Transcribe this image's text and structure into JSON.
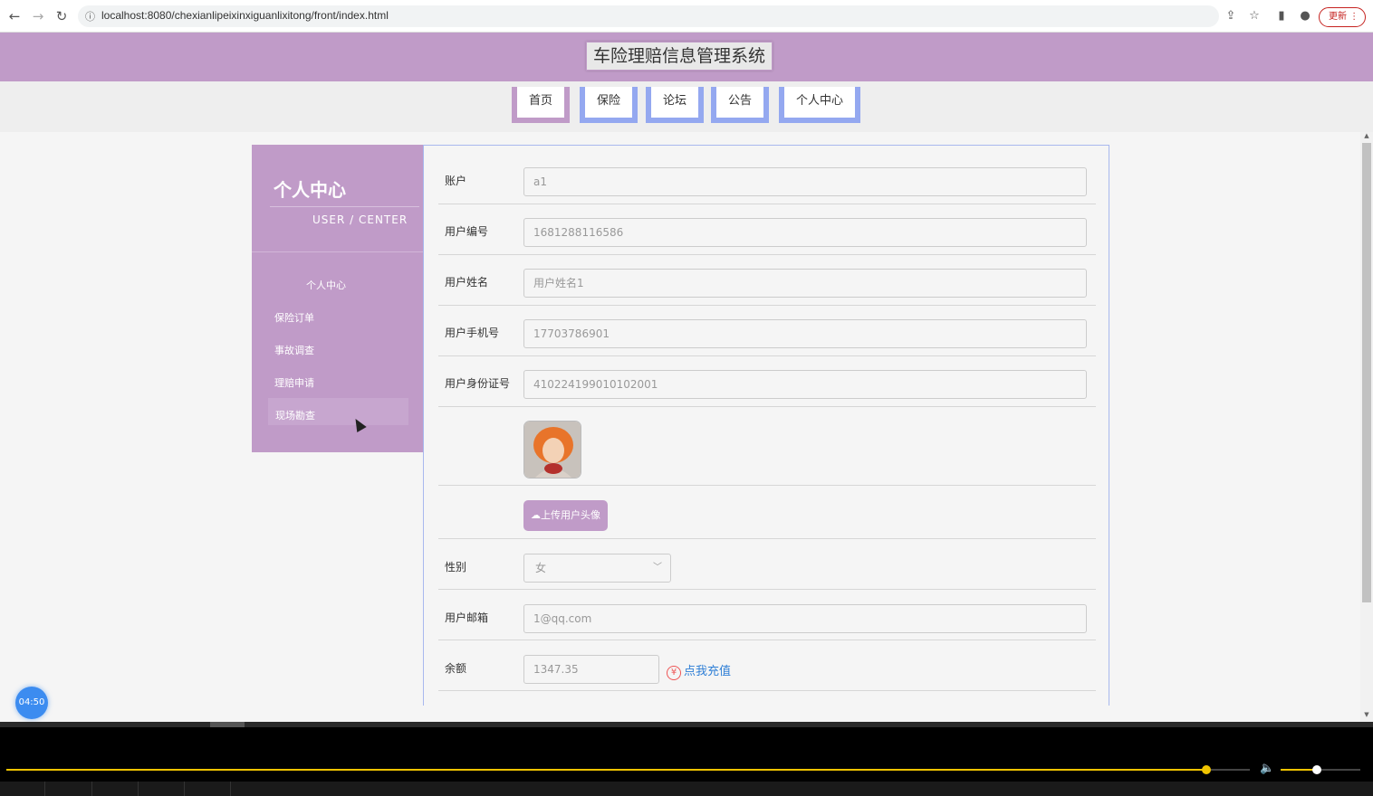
{
  "browser": {
    "url": "localhost:8080/chexianlipeixinxiguanlixitong/front/index.html",
    "update_label": "更新"
  },
  "site": {
    "title": "车险理赔信息管理系统"
  },
  "nav": {
    "items": [
      {
        "label": "首页",
        "active": true
      },
      {
        "label": "保险",
        "active": false
      },
      {
        "label": "论坛",
        "active": false
      },
      {
        "label": "公告",
        "active": false
      },
      {
        "label": "个人中心",
        "active": false
      }
    ]
  },
  "sidebar": {
    "title": "个人中心",
    "subtitle": "USER / CENTER",
    "items": [
      "个人中心",
      "保险订单",
      "事故调查",
      "理赔申请",
      "现场勘查"
    ]
  },
  "form": {
    "account_label": "账户",
    "account_value": "a1",
    "user_no_label": "用户编号",
    "user_no_value": "1681288116586",
    "user_name_label": "用户姓名",
    "user_name_value": "用户姓名1",
    "phone_label": "用户手机号",
    "phone_value": "17703786901",
    "id_card_label": "用户身份证号",
    "id_card_value": "410224199010102001",
    "upload_label": "上传用户头像",
    "gender_label": "性别",
    "gender_value": "女",
    "email_label": "用户邮箱",
    "email_value": "1@qq.com",
    "balance_label": "余额",
    "balance_value": "1347.35",
    "recharge_label": "点我充值"
  },
  "timer": {
    "label": "04:50"
  },
  "player": {
    "progress": 0.965,
    "volume": 0.45
  },
  "colors": {
    "accent": "#c09bc8",
    "nav_border": "#94a8f0",
    "link": "#2f7fd6",
    "progress": "#f0c400"
  }
}
